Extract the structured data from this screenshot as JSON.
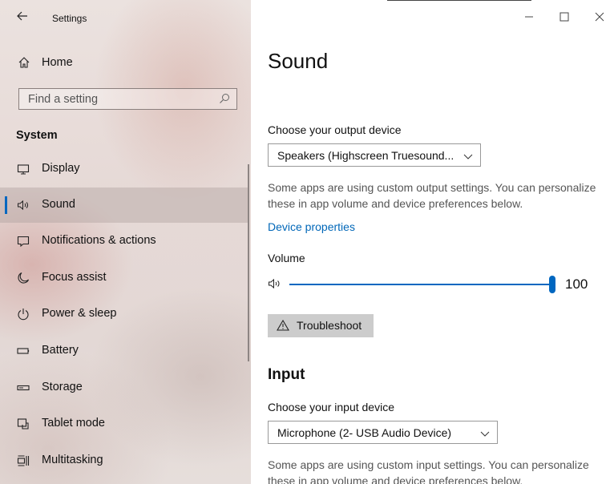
{
  "window": {
    "title": "Settings",
    "back_icon": "back-arrow-icon",
    "controls": [
      "minimize-icon",
      "maximize-icon",
      "close-icon"
    ]
  },
  "sidebar": {
    "home": {
      "label": "Home",
      "icon": "home-icon"
    },
    "search": {
      "placeholder": "Find a setting",
      "icon": "search-icon"
    },
    "section": "System",
    "items": [
      {
        "label": "Display",
        "icon": "display-icon"
      },
      {
        "label": "Sound",
        "icon": "speaker-icon",
        "active": true
      },
      {
        "label": "Notifications & actions",
        "icon": "notification-icon"
      },
      {
        "label": "Focus assist",
        "icon": "moon-icon"
      },
      {
        "label": "Power & sleep",
        "icon": "power-icon"
      },
      {
        "label": "Battery",
        "icon": "battery-icon"
      },
      {
        "label": "Storage",
        "icon": "storage-icon"
      },
      {
        "label": "Tablet mode",
        "icon": "tablet-mode-icon"
      },
      {
        "label": "Multitasking",
        "icon": "multitasking-icon"
      }
    ]
  },
  "main": {
    "title": "Sound",
    "output": {
      "label": "Choose your output device",
      "selected": "Speakers (Highscreen Truesound...",
      "description": "Some apps are using custom output settings. You can personalize these in app volume and device preferences below.",
      "link": "Device properties"
    },
    "volume": {
      "label": "Volume",
      "value": "100",
      "level": 1.0
    },
    "troubleshoot": {
      "label": "Troubleshoot",
      "icon": "warning-icon"
    },
    "input": {
      "heading": "Input",
      "label": "Choose your input device",
      "selected": "Microphone (2- USB Audio Device)",
      "description": "Some apps are using custom input settings. You can personalize these in app volume and device preferences below."
    }
  },
  "colors": {
    "accent": "#0067c0",
    "link": "#0067b8"
  }
}
